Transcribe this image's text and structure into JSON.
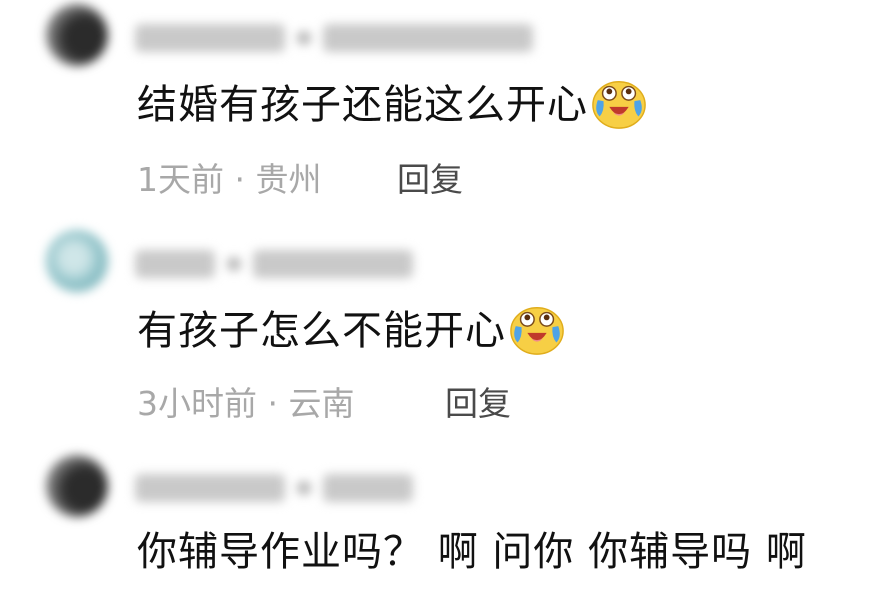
{
  "comments": [
    {
      "text": "结婚有孩子还能这么开心",
      "has_emoji": true,
      "time": "1天前",
      "separator": "·",
      "location": "贵州",
      "reply_label": "回复"
    },
    {
      "text": "有孩子怎么不能开心",
      "has_emoji": true,
      "time": "3小时前",
      "separator": "·",
      "location": "云南",
      "reply_label": "回复"
    },
    {
      "text": "你辅导作业吗？ 啊 问你 你辅导吗 啊",
      "has_emoji": false
    }
  ],
  "icons": {
    "emoji": "laughing-tears-emoji-icon"
  },
  "colors": {
    "text": "#111111",
    "meta": "#a8a8a8",
    "reply": "#4a4a4a",
    "emoji_face": "#f7cf45",
    "emoji_tears": "#4fa3e6"
  }
}
